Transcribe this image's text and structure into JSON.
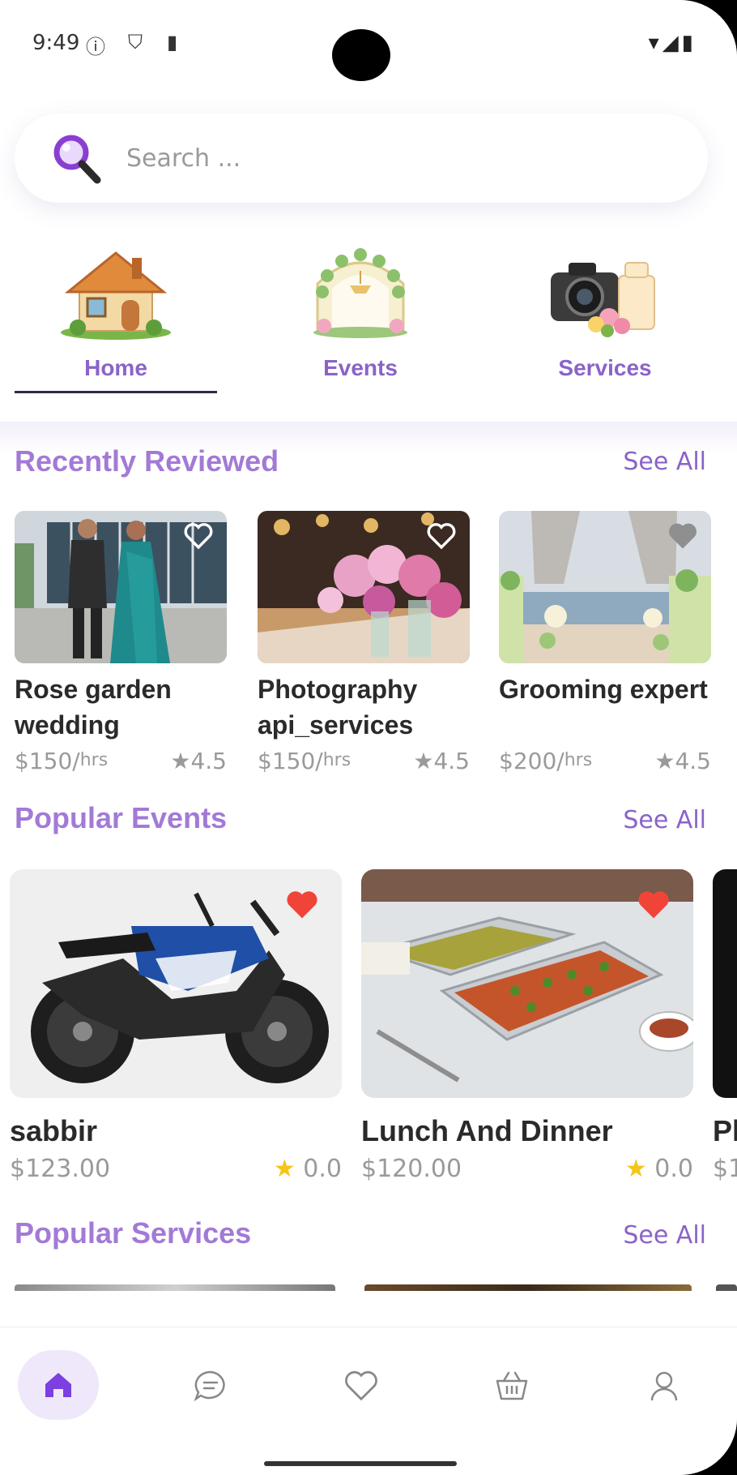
{
  "status_bar": {
    "time": "9:49"
  },
  "search": {
    "placeholder": "Search ..."
  },
  "tabs": [
    {
      "label": "Home",
      "icon": "house-icon",
      "selected": true
    },
    {
      "label": "Events",
      "icon": "wedding-arch-icon",
      "selected": false
    },
    {
      "label": "Services",
      "icon": "camera-cake-icon",
      "selected": false
    }
  ],
  "recently_reviewed": {
    "title": "Recently Reviewed",
    "see_all": "See All",
    "items": [
      {
        "title": "Rose garden wedding",
        "price": "$150/",
        "unit": "hrs",
        "rating": "4.5"
      },
      {
        "title": "Photography api_services",
        "price": "$150/",
        "unit": "hrs",
        "rating": "4.5"
      },
      {
        "title": "Grooming expert",
        "price": "$200/",
        "unit": "hrs",
        "rating": "4.5"
      }
    ]
  },
  "popular_events": {
    "title": "Popular Events",
    "see_all": "See All",
    "items": [
      {
        "title": "sabbir",
        "price": "$123.00",
        "rating": "0.0"
      },
      {
        "title": "Lunch And Dinner",
        "price": "$120.00",
        "rating": "0.0"
      },
      {
        "title": "Pl",
        "price": "$1"
      }
    ]
  },
  "popular_services": {
    "title": "Popular Services",
    "see_all": "See All"
  },
  "colors": {
    "accent": "#8a63c9",
    "heading": "#a27ad6",
    "heart_active": "#f04438",
    "star": "#f5c518"
  }
}
